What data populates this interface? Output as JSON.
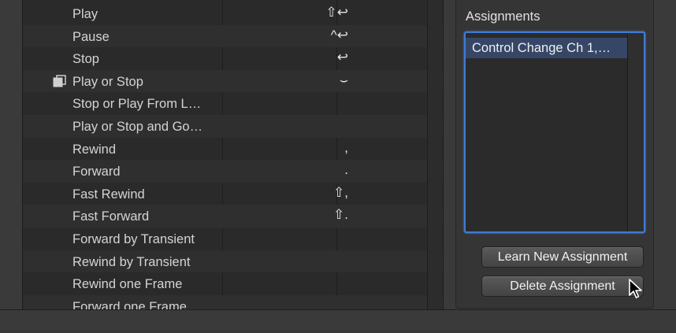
{
  "commands": [
    {
      "label": "Play",
      "shortcut": "⇧↩",
      "icon": ""
    },
    {
      "label": "Pause",
      "shortcut": "^↩",
      "icon": ""
    },
    {
      "label": "Stop",
      "shortcut": "↩",
      "icon": ""
    },
    {
      "label": "Play or Stop",
      "shortcut": "⌣",
      "icon": "stacked-pages-icon"
    },
    {
      "label": "Stop or Play From L…",
      "shortcut": "",
      "icon": ""
    },
    {
      "label": "Play or Stop and Go…",
      "shortcut": "",
      "icon": ""
    },
    {
      "label": "Rewind",
      "shortcut": ",",
      "icon": ""
    },
    {
      "label": "Forward",
      "shortcut": ".",
      "icon": ""
    },
    {
      "label": "Fast Rewind",
      "shortcut": "⇧,",
      "icon": ""
    },
    {
      "label": "Fast Forward",
      "shortcut": "⇧.",
      "icon": ""
    },
    {
      "label": "Forward by Transient",
      "shortcut": "",
      "icon": ""
    },
    {
      "label": "Rewind by Transient",
      "shortcut": "",
      "icon": ""
    },
    {
      "label": "Rewind one Frame",
      "shortcut": "",
      "icon": ""
    },
    {
      "label": "Forward one Frame",
      "shortcut": "",
      "icon": ""
    }
  ],
  "assignments": {
    "title": "Assignments",
    "items": [
      "Control Change Ch 1,…"
    ],
    "learn_button": "Learn New Assignment",
    "delete_button": "Delete Assignment"
  },
  "icons": {
    "cursor": "arrow-cursor-icon"
  },
  "colors": {
    "accent": "#3f7bd6",
    "selection": "#364667"
  }
}
